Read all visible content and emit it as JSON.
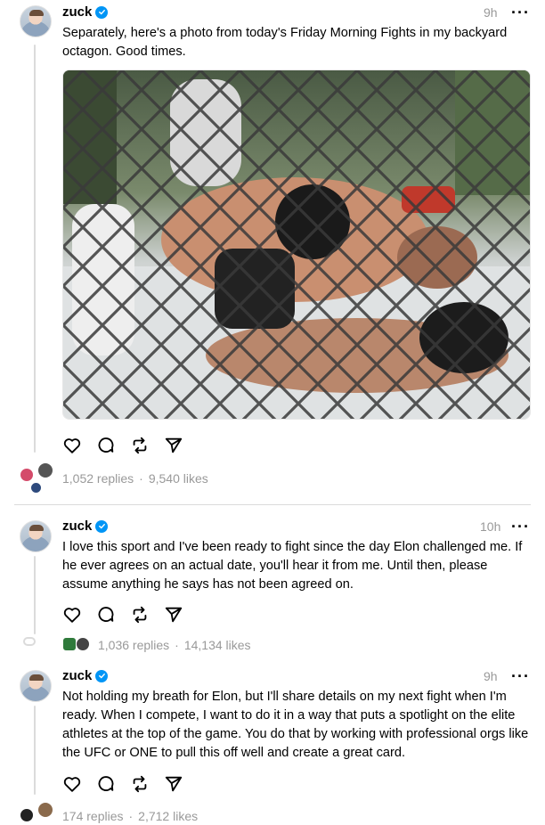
{
  "posts": [
    {
      "username": "zuck",
      "time": "9h",
      "text": "Separately, here's a photo from today's Friday Morning Fights in my backyard octagon. Good times.",
      "replies": "1,052 replies",
      "likes": "9,540 likes",
      "separator": "·"
    },
    {
      "username": "zuck",
      "time": "10h",
      "text": "I love this sport and I've been ready to fight since the day Elon challenged me. If he ever agrees on an actual date, you'll hear it from me. Until then, please assume anything he says has not been agreed on.",
      "replies": "1,036 replies",
      "likes": "14,134 likes",
      "separator": "·"
    },
    {
      "username": "zuck",
      "time": "9h",
      "text": "Not holding my breath for Elon, but I'll share details on my next fight when I'm ready. When I compete, I want to do it in a way that puts a spotlight on the elite athletes at the top of the game. You do that by working with professional orgs like the UFC or ONE to pull this off well and create a great card.",
      "replies": "174 replies",
      "likes": "2,712 likes",
      "separator": "·"
    }
  ],
  "more_label": "···",
  "colors": {
    "verified": "#0095f6",
    "muted": "#999999",
    "divider": "#dbdbdb"
  },
  "icons": [
    "heart-icon",
    "comment-icon",
    "repost-icon",
    "share-icon",
    "verified-icon",
    "more-icon"
  ]
}
